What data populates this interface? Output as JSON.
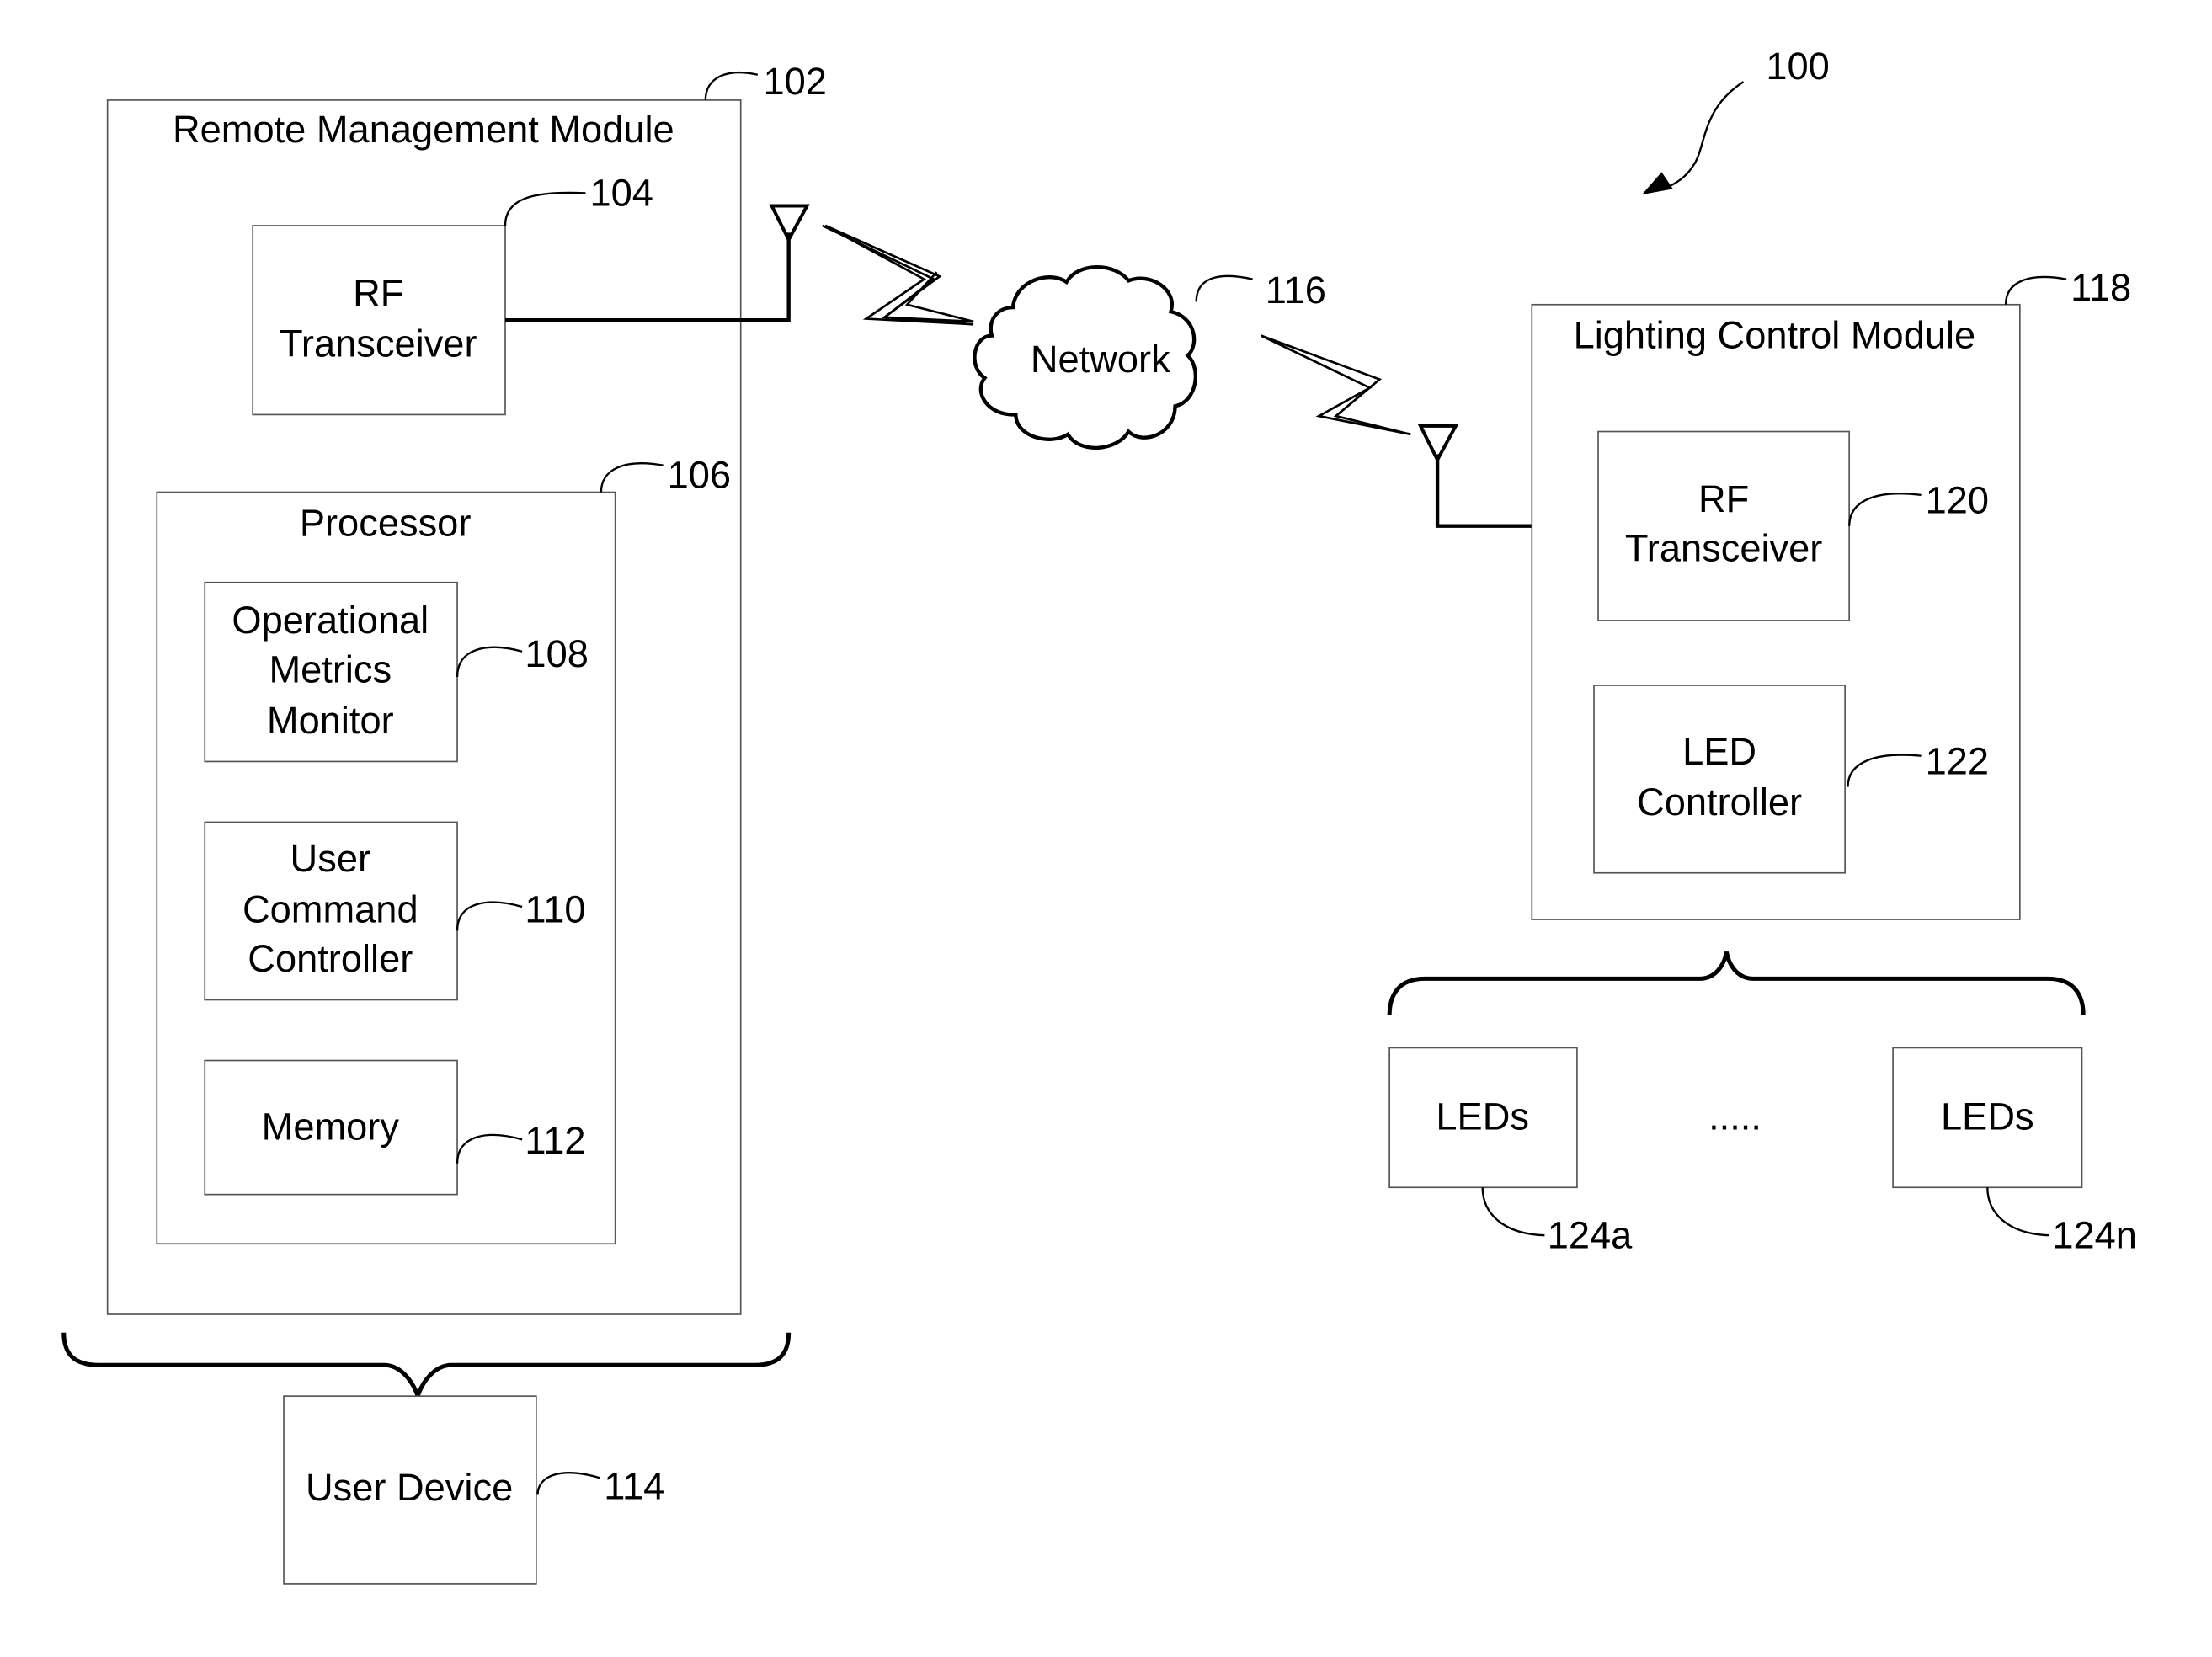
{
  "figure": {
    "ref": "100",
    "remote_management_module": {
      "title": "Remote Management Module",
      "ref": "102",
      "rf_transceiver": {
        "lines": [
          "RF",
          "Transceiver"
        ],
        "ref": "104"
      },
      "processor": {
        "title": "Processor",
        "ref": "106",
        "operational_metrics_monitor": {
          "lines": [
            "Operational",
            "Metrics",
            "Monitor"
          ],
          "ref": "108"
        },
        "user_command_controller": {
          "lines": [
            "User",
            "Command",
            "Controller"
          ],
          "ref": "110"
        },
        "memory": {
          "label": "Memory",
          "ref": "112"
        }
      }
    },
    "user_device": {
      "label": "User Device",
      "ref": "114"
    },
    "network": {
      "label": "Network",
      "ref": "116"
    },
    "lighting_control_module": {
      "title": "Lighting Control Module",
      "ref": "118",
      "rf_transceiver": {
        "lines": [
          "RF",
          "Transceiver"
        ],
        "ref": "120"
      },
      "led_controller": {
        "lines": [
          "LED",
          "Controller"
        ],
        "ref": "122"
      }
    },
    "leds": [
      {
        "label": "LEDs",
        "ref": "124a"
      },
      {
        "label": "LEDs",
        "ref": "124n"
      }
    ],
    "ellipsis": "....."
  }
}
